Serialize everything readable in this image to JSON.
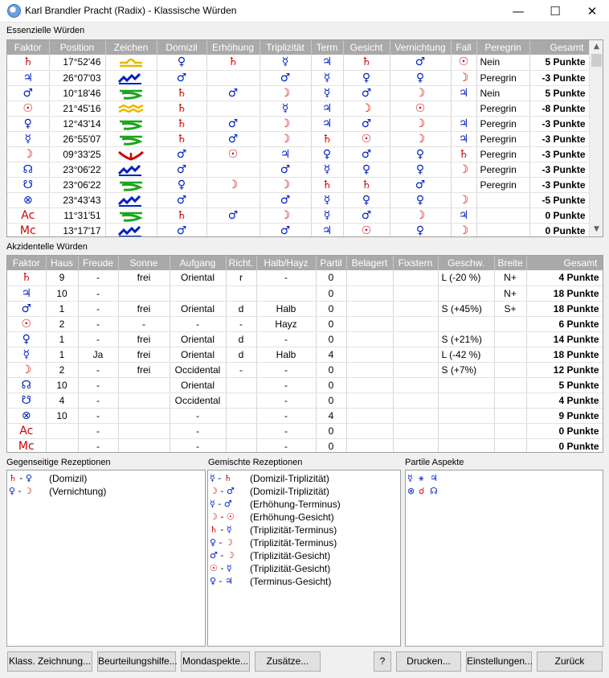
{
  "window": {
    "title": "Karl Brandler Pracht (Radix) - Klassische Würden",
    "min": "—",
    "max": "☐",
    "close": "✕"
  },
  "essential": {
    "label": "Essenzielle Würden",
    "headers": [
      "Faktor",
      "Position",
      "Zeichen",
      "Domizil",
      "Erhöhung",
      "Triplizität",
      "Term",
      "Gesicht",
      "Vernichtung",
      "Fall",
      "Peregrin",
      "Gesamt"
    ],
    "rows": [
      {
        "f": "♄",
        "fc": "red",
        "pos": "17°52'46",
        "sign": "libra",
        "dom": "♀",
        "domc": "blue",
        "erh": "♄",
        "erhc": "red",
        "tri": "☿",
        "tric": "blue",
        "term": "♃",
        "termc": "blue",
        "ges": "♄",
        "gesc": "red",
        "ver": "♂",
        "verc": "blue",
        "fall": "☉",
        "fallc": "red",
        "per": "Nein",
        "tot": "5 Punkte"
      },
      {
        "f": "♃",
        "fc": "blue",
        "pos": "26°07'03",
        "sign": "aquarius",
        "dom": "♂",
        "domc": "blue",
        "erh": "",
        "erhc": "",
        "tri": "♂",
        "tric": "blue",
        "term": "☿",
        "termc": "blue",
        "ges": "♀",
        "gesc": "blue",
        "ver": "♀",
        "verc": "blue",
        "fall": "☽",
        "fallc": "red",
        "per": "Peregrin",
        "tot": "-3 Punkte"
      },
      {
        "f": "♂",
        "fc": "blue",
        "pos": "10°18'46",
        "sign": "capricorn",
        "dom": "♄",
        "domc": "red",
        "erh": "♂",
        "erhc": "blue",
        "tri": "☽",
        "tric": "red",
        "term": "☿",
        "termc": "blue",
        "ges": "♂",
        "gesc": "blue",
        "ver": "☽",
        "verc": "red",
        "fall": "♃",
        "fallc": "blue",
        "per": "Nein",
        "tot": "5 Punkte"
      },
      {
        "f": "☉",
        "fc": "red",
        "pos": "21°45'16",
        "sign": "aquarius2",
        "dom": "♄",
        "domc": "red",
        "erh": "",
        "erhc": "",
        "tri": "☿",
        "tric": "blue",
        "term": "♃",
        "termc": "blue",
        "ges": "☽",
        "gesc": "red",
        "ver": "☉",
        "verc": "red",
        "fall": "",
        "fallc": "",
        "per": "Peregrin",
        "tot": "-8 Punkte"
      },
      {
        "f": "♀",
        "fc": "blue",
        "pos": "12°43'14",
        "sign": "capricorn",
        "dom": "♄",
        "domc": "red",
        "erh": "♂",
        "erhc": "blue",
        "tri": "☽",
        "tric": "red",
        "term": "♃",
        "termc": "blue",
        "ges": "♂",
        "gesc": "blue",
        "ver": "☽",
        "verc": "red",
        "fall": "♃",
        "fallc": "blue",
        "per": "Peregrin",
        "tot": "-3 Punkte"
      },
      {
        "f": "☿",
        "fc": "blue",
        "pos": "26°55'07",
        "sign": "capricorn",
        "dom": "♄",
        "domc": "red",
        "erh": "♂",
        "erhc": "blue",
        "tri": "☽",
        "tric": "red",
        "term": "♄",
        "termc": "red",
        "ges": "☉",
        "gesc": "red",
        "ver": "☽",
        "verc": "red",
        "fall": "♃",
        "fallc": "blue",
        "per": "Peregrin",
        "tot": "-3 Punkte"
      },
      {
        "f": "☽",
        "fc": "red",
        "pos": "09°33'25",
        "sign": "aries",
        "dom": "♂",
        "domc": "blue",
        "erh": "☉",
        "erhc": "red",
        "tri": "♃",
        "tric": "blue",
        "term": "♀",
        "termc": "blue",
        "ges": "♂",
        "gesc": "blue",
        "ver": "♀",
        "verc": "blue",
        "fall": "♄",
        "fallc": "red",
        "per": "Peregrin",
        "tot": "-3 Punkte"
      },
      {
        "f": "☊",
        "fc": "blue",
        "pos": "23°06'22",
        "sign": "aquarius",
        "dom": "♂",
        "domc": "blue",
        "erh": "",
        "erhc": "",
        "tri": "♂",
        "tric": "blue",
        "term": "☿",
        "termc": "blue",
        "ges": "♀",
        "gesc": "blue",
        "ver": "♀",
        "verc": "blue",
        "fall": "☽",
        "fallc": "red",
        "per": "Peregrin",
        "tot": "-3 Punkte"
      },
      {
        "f": "☋",
        "fc": "blue",
        "pos": "23°06'22",
        "sign": "capricorn",
        "dom": "♀",
        "domc": "blue",
        "erh": "☽",
        "erhc": "red",
        "tri": "☽",
        "tric": "red",
        "term": "♄",
        "termc": "red",
        "ges": "♄",
        "gesc": "red",
        "ver": "♂",
        "verc": "blue",
        "fall": "",
        "fallc": "",
        "per": "Peregrin",
        "tot": "-3 Punkte"
      },
      {
        "f": "⊗",
        "fc": "blue",
        "pos": "23°43'43",
        "sign": "aquarius",
        "dom": "♂",
        "domc": "blue",
        "erh": "",
        "erhc": "",
        "tri": "♂",
        "tric": "blue",
        "term": "☿",
        "termc": "blue",
        "ges": "♀",
        "gesc": "blue",
        "ver": "♀",
        "verc": "blue",
        "fall": "☽",
        "fallc": "red",
        "per": "",
        "tot": "-5 Punkte"
      },
      {
        "f": "Ac",
        "fc": "red",
        "pos": "11°31'51",
        "sign": "capricorn",
        "dom": "♄",
        "domc": "red",
        "erh": "♂",
        "erhc": "blue",
        "tri": "☽",
        "tric": "red",
        "term": "☿",
        "termc": "blue",
        "ges": "♂",
        "gesc": "blue",
        "ver": "☽",
        "verc": "red",
        "fall": "♃",
        "fallc": "blue",
        "per": "",
        "tot": "0 Punkte"
      },
      {
        "f": "Mc",
        "fc": "red",
        "pos": "13°17'17",
        "sign": "aquarius",
        "dom": "♂",
        "domc": "blue",
        "erh": "",
        "erhc": "",
        "tri": "♂",
        "tric": "blue",
        "term": "♃",
        "termc": "blue",
        "ges": "☉",
        "gesc": "red",
        "ver": "♀",
        "verc": "blue",
        "fall": "☽",
        "fallc": "red",
        "per": "",
        "tot": "0 Punkte"
      }
    ]
  },
  "accidental": {
    "label": "Akzidentelle Würden",
    "headers": [
      "Faktor",
      "Haus",
      "Freude",
      "Sonne",
      "Aufgang",
      "Richt.",
      "Halb/Hayz",
      "Partil",
      "Belagert",
      "Fixstern",
      "Geschw.",
      "Breite",
      "Gesamt"
    ],
    "rows": [
      {
        "f": "♄",
        "fc": "red",
        "haus": "9",
        "freude": "-",
        "sonne": "frei",
        "auf": "Oriental",
        "richt": "r",
        "halb": "-",
        "partil": "0",
        "bel": "",
        "fix": "",
        "gesch": "L (-20 %)",
        "breite": "N+",
        "tot": "4 Punkte"
      },
      {
        "f": "♃",
        "fc": "blue",
        "haus": "10",
        "freude": "-",
        "sonne": "",
        "auf": "",
        "richt": "",
        "halb": "",
        "partil": "0",
        "bel": "",
        "fix": "",
        "gesch": "",
        "breite": "N+",
        "tot": "18 Punkte"
      },
      {
        "f": "♂",
        "fc": "blue",
        "haus": "1",
        "freude": "-",
        "sonne": "frei",
        "auf": "Oriental",
        "richt": "d",
        "halb": "Halb",
        "partil": "0",
        "bel": "",
        "fix": "",
        "gesch": "S (+45%)",
        "breite": "S+",
        "tot": "18 Punkte"
      },
      {
        "f": "☉",
        "fc": "red",
        "haus": "2",
        "freude": "-",
        "sonne": "-",
        "auf": "-",
        "richt": "-",
        "halb": "Hayz",
        "partil": "0",
        "bel": "",
        "fix": "",
        "gesch": "",
        "breite": "",
        "tot": "6 Punkte"
      },
      {
        "f": "♀",
        "fc": "blue",
        "haus": "1",
        "freude": "-",
        "sonne": "frei",
        "auf": "Oriental",
        "richt": "d",
        "halb": "-",
        "partil": "0",
        "bel": "",
        "fix": "",
        "gesch": "S (+21%)",
        "breite": "",
        "tot": "14 Punkte"
      },
      {
        "f": "☿",
        "fc": "blue",
        "haus": "1",
        "freude": "Ja",
        "sonne": "frei",
        "auf": "Oriental",
        "richt": "d",
        "halb": "Halb",
        "partil": "4",
        "bel": "",
        "fix": "",
        "gesch": "L (-42 %)",
        "breite": "",
        "tot": "18 Punkte"
      },
      {
        "f": "☽",
        "fc": "red",
        "haus": "2",
        "freude": "-",
        "sonne": "frei",
        "auf": "Occidental",
        "richt": "-",
        "halb": "-",
        "partil": "0",
        "bel": "",
        "fix": "",
        "gesch": "S (+7%)",
        "breite": "",
        "tot": "12 Punkte"
      },
      {
        "f": "☊",
        "fc": "blue",
        "haus": "10",
        "freude": "-",
        "sonne": "",
        "auf": "Oriental",
        "richt": "",
        "halb": "-",
        "partil": "0",
        "bel": "",
        "fix": "",
        "gesch": "",
        "breite": "",
        "tot": "5 Punkte"
      },
      {
        "f": "☋",
        "fc": "blue",
        "haus": "4",
        "freude": "-",
        "sonne": "",
        "auf": "Occidental",
        "richt": "",
        "halb": "-",
        "partil": "0",
        "bel": "",
        "fix": "",
        "gesch": "",
        "breite": "",
        "tot": "4 Punkte"
      },
      {
        "f": "⊗",
        "fc": "blue",
        "haus": "10",
        "freude": "-",
        "sonne": "",
        "auf": "-",
        "richt": "",
        "halb": "-",
        "partil": "4",
        "bel": "",
        "fix": "",
        "gesch": "",
        "breite": "",
        "tot": "9 Punkte"
      },
      {
        "f": "Ac",
        "fc": "red",
        "haus": "",
        "freude": "-",
        "sonne": "",
        "auf": "-",
        "richt": "",
        "halb": "-",
        "partil": "0",
        "bel": "",
        "fix": "",
        "gesch": "",
        "breite": "",
        "tot": "0 Punkte"
      },
      {
        "f": "Mc",
        "fc": "red",
        "haus": "",
        "freude": "-",
        "sonne": "",
        "auf": "-",
        "richt": "",
        "halb": "-",
        "partil": "0",
        "bel": "",
        "fix": "",
        "gesch": "",
        "breite": "",
        "tot": "0 Punkte"
      }
    ]
  },
  "mutual": {
    "label": "Gegenseitige Rezeptionen",
    "items": [
      {
        "a": "♄",
        "ac": "red",
        "b": "♀",
        "bc": "blue",
        "text": "(Domizil)"
      },
      {
        "a": "♀",
        "ac": "blue",
        "b": "☽",
        "bc": "red",
        "text": "(Vernichtung)"
      }
    ]
  },
  "mixed": {
    "label": "Gemischte Rezeptionen",
    "items": [
      {
        "a": "☿",
        "ac": "blue",
        "b": "♄",
        "bc": "red",
        "text": "(Domizil-Triplizität)"
      },
      {
        "a": "☽",
        "ac": "red",
        "b": "♂",
        "bc": "blue",
        "text": "(Domizil-Triplizität)"
      },
      {
        "a": "☿",
        "ac": "blue",
        "b": "♂",
        "bc": "blue",
        "text": "(Erhöhung-Terminus)"
      },
      {
        "a": "☽",
        "ac": "red",
        "b": "☉",
        "bc": "red",
        "text": "(Erhöhung-Gesicht)"
      },
      {
        "a": "♄",
        "ac": "red",
        "b": "☿",
        "bc": "blue",
        "text": "(Triplizität-Terminus)"
      },
      {
        "a": "♀",
        "ac": "blue",
        "b": "☽",
        "bc": "red",
        "text": "(Triplizität-Terminus)"
      },
      {
        "a": "♂",
        "ac": "blue",
        "b": "☽",
        "bc": "red",
        "text": "(Triplizität-Gesicht)"
      },
      {
        "a": "☉",
        "ac": "red",
        "b": "☿",
        "bc": "blue",
        "text": "(Triplizität-Gesicht)"
      },
      {
        "a": "♀",
        "ac": "blue",
        "b": "♃",
        "bc": "blue",
        "text": "(Terminus-Gesicht)"
      }
    ]
  },
  "partile": {
    "label": "Partile Aspekte",
    "items": [
      {
        "a": "☿",
        "ac": "blue",
        "asp": "⚹",
        "aspc": "blue",
        "b": "♃",
        "bc": "blue"
      },
      {
        "a": "⊗",
        "ac": "blue",
        "asp": "☌",
        "aspc": "red",
        "b": "☊",
        "bc": "blue"
      }
    ]
  },
  "buttons": {
    "klass": "Klass. Zeichnung...",
    "beurteilung": "Beurteilungshilfe...",
    "mond": "Mondaspekte...",
    "zusaetze": "Zusätze...",
    "help": "?",
    "drucken": "Drucken...",
    "einstellungen": "Einstellungen...",
    "zurueck": "Zurück"
  },
  "colors": {
    "red": "#d00000",
    "blue": "#0020c0",
    "header": "#a9a9a9"
  }
}
